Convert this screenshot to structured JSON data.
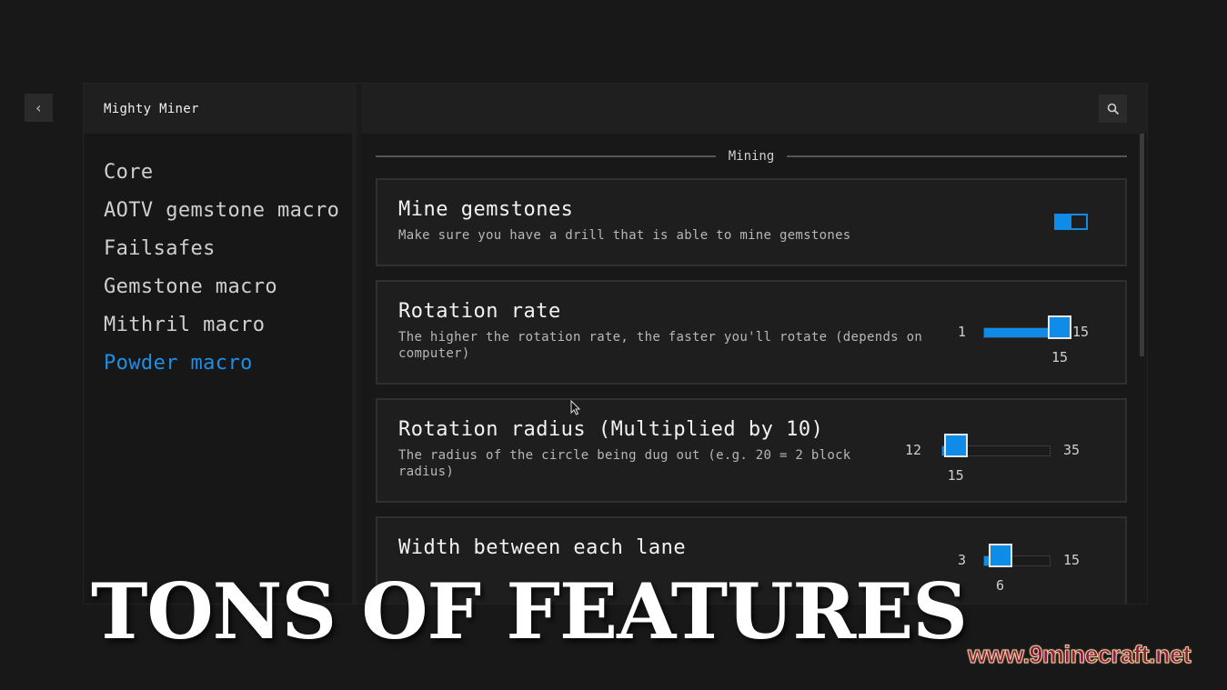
{
  "nav": {
    "back_icon": "chevron-left-icon"
  },
  "app": {
    "title": "Mighty Miner"
  },
  "sidebar": {
    "items": [
      {
        "label": "Core",
        "active": false
      },
      {
        "label": "AOTV gemstone macro",
        "active": false
      },
      {
        "label": "Failsafes",
        "active": false
      },
      {
        "label": "Gemstone macro",
        "active": false
      },
      {
        "label": "Mithril macro",
        "active": false
      },
      {
        "label": "Powder macro",
        "active": true
      }
    ]
  },
  "header": {
    "search_icon": "search-icon"
  },
  "section": {
    "label": "Mining"
  },
  "settings": [
    {
      "type": "toggle",
      "title": "Mine gemstones",
      "description": "Make sure you have a drill that is able to mine gemstones",
      "value": true
    },
    {
      "type": "slider",
      "title": "Rotation rate",
      "description": "The higher the rotation rate, the faster you'll rotate (depends on computer)",
      "min": 1,
      "max": 15,
      "value": 15,
      "min_label": "1",
      "max_label": "15",
      "value_label": "15"
    },
    {
      "type": "slider",
      "title": "Rotation radius (Multiplied by 10)",
      "description": "The radius of the circle being dug out (e.g. 20 = 2 block radius)",
      "min": 12,
      "max": 35,
      "value": 15,
      "min_label": "12",
      "max_label": "35",
      "value_label": "15"
    },
    {
      "type": "slider",
      "title": "Width between each lane",
      "description": "",
      "min": 3,
      "max": 15,
      "value": 6,
      "min_label": "3",
      "max_label": "15",
      "value_label": "6"
    }
  ],
  "colors": {
    "accent": "#0f8be8",
    "active_nav": "#1e8fe6"
  },
  "overlay": {
    "title": "TONS OF FEATURES",
    "watermark": "www.9minecraft.net"
  }
}
